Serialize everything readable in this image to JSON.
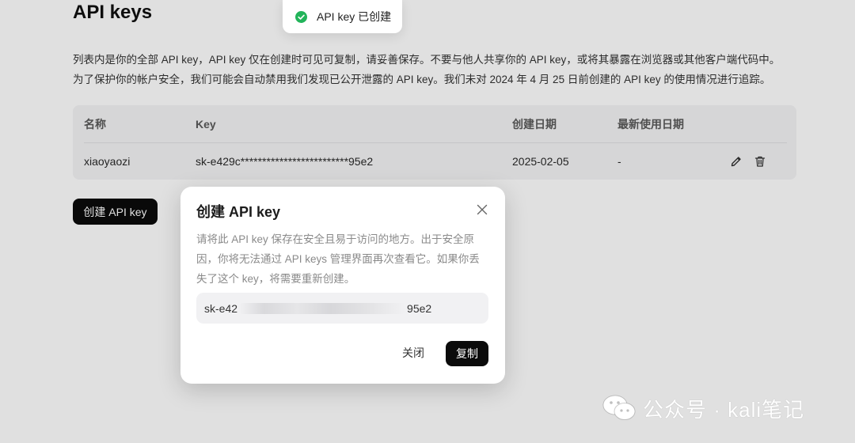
{
  "page": {
    "title": "API keys",
    "description": [
      "列表内是你的全部 API key，API key 仅在创建时可见可复制，请妥善保存。不要与他人共享你的 API key，或将其暴露在浏览器或其他客户端代码中。",
      "为了保护你的帐户安全，我们可能会自动禁用我们发现已公开泄露的 API key。我们未对 2024 年 4 月 25 日前创建的 API key 的使用情况进行追踪。"
    ],
    "create_button": "创建 API key"
  },
  "table": {
    "columns": [
      "名称",
      "Key",
      "创建日期",
      "最新使用日期"
    ],
    "rows": [
      {
        "name": "xiaoyaozi",
        "key": "sk-e429c*************************95e2",
        "created": "2025-02-05",
        "last_used": "-"
      }
    ]
  },
  "toast": {
    "text": "API key 已创建",
    "icon": "check-circle-icon",
    "color": "#22b45a"
  },
  "modal": {
    "title": "创建 API key",
    "body": "请将此 API key 保存在安全且易于访问的地方。出于安全原因，你将无法通过 API keys 管理界面再次查看它。如果你丢失了这个 key，将需要重新创建。",
    "key_prefix": "sk-e42",
    "key_suffix": "95e2",
    "close_label": "关闭",
    "copy_label": "复制"
  },
  "watermark": {
    "text": "公众号 · kali笔记",
    "icon": "wechat-icon"
  },
  "colors": {
    "accent": "#0b0b0b",
    "success": "#22b45a"
  }
}
